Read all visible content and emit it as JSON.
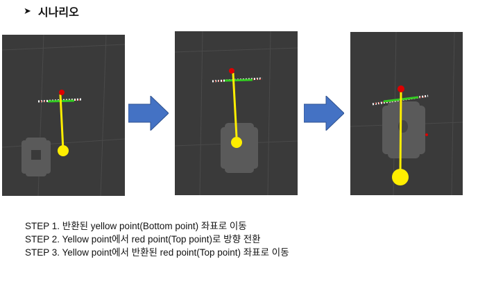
{
  "header": {
    "bullet_icon": "arrowhead-bullet-icon",
    "title": "시나리오"
  },
  "panels": [
    {
      "name": "step1-view",
      "caption": ""
    },
    {
      "name": "step2-view",
      "caption": ""
    },
    {
      "name": "step3-view",
      "caption": ""
    }
  ],
  "arrows": [
    {
      "icon": "right-arrow-icon",
      "color": "#4472c4"
    },
    {
      "icon": "right-arrow-icon",
      "color": "#4472c4"
    }
  ],
  "colors": {
    "viewer_bg": "#3a3a3a",
    "yellow_point": "#ffee00",
    "red_point": "#dd0000",
    "green_bar": "#33cc22",
    "arrow_fill": "#4472c4"
  },
  "steps": [
    "STEP 1. 반환된 yellow point(Bottom point) 좌표로 이동",
    "STEP 2. Yellow point에서 red point(Top point)로 방향 전환",
    "STEP 3. Yellow point에서 반환된 red point(Top point) 좌표로 이동"
  ]
}
